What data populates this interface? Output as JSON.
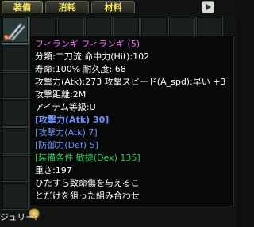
{
  "tabs": [
    {
      "label": "装備"
    },
    {
      "label": "消耗"
    },
    {
      "label": "材料"
    }
  ],
  "nav_icon": "arrow-right-icon",
  "item_icon": "twin-swords-icon",
  "tooltip": {
    "title": "フィランギ フィランギ (5)",
    "line1": "分類:二刀流 命中力(Hit):102",
    "line2": "寿命:100% 耐久度: 68",
    "line3": "攻撃力(Atk):273 攻撃スピード(A_spd):早い +3",
    "line4": "攻撃距離:2M",
    "line5": "アイテム等級:U",
    "line6": "[攻撃力(Atk) 30]",
    "line7": "[攻撃力(Atk) 7]",
    "line8": "[防御力(Def) 5]",
    "line9": "[装備条件 敏捷(Dex) 135]",
    "line10": "重さ:197",
    "line11": "ひたすら致命傷を与えるこ",
    "line12": "とだけを狙った組み合わせ"
  },
  "bottom_label": "ジュリー:"
}
